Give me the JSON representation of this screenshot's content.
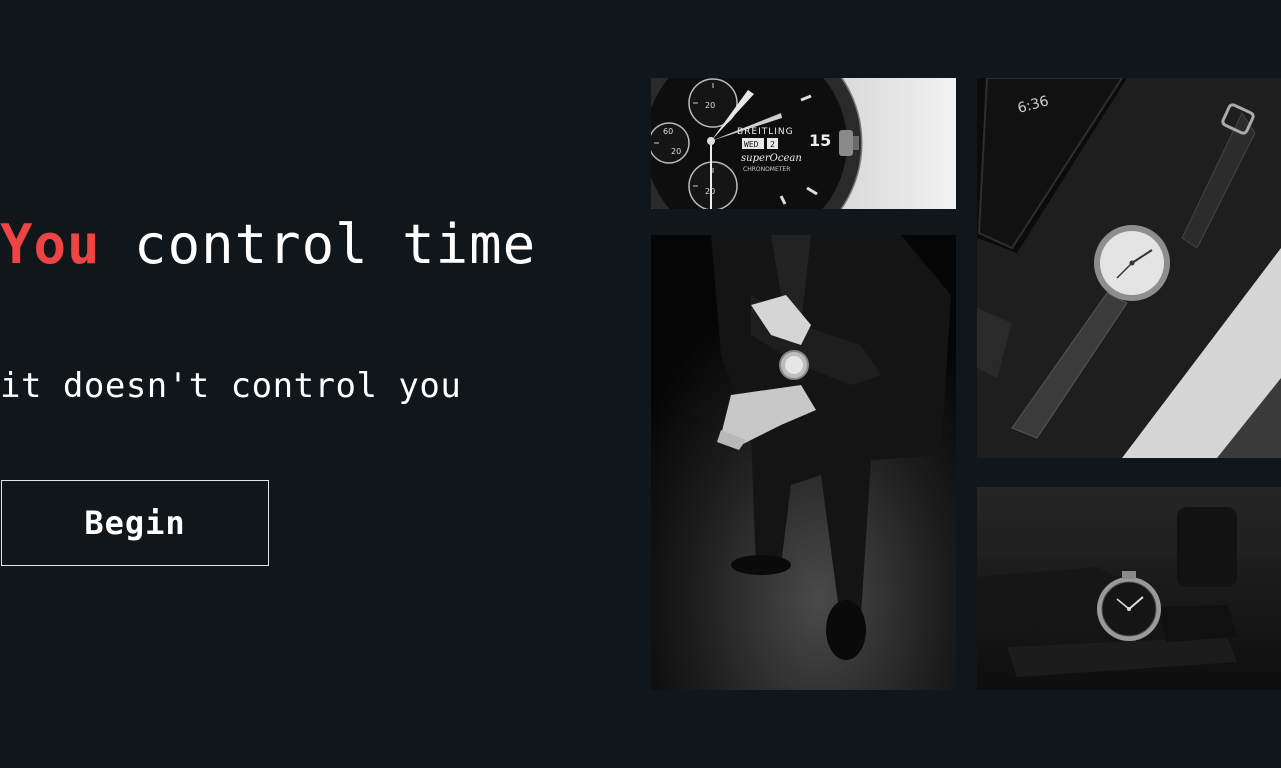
{
  "hero": {
    "title_accent": "You",
    "title_rest": " control time",
    "subtitle": "it doesn't control you",
    "cta_label": "Begin"
  },
  "gallery": {
    "tile1": {
      "brand": "BREITLING",
      "day": "WED",
      "date": "2",
      "model": "superOcean",
      "model_sub": "CHRONOMETER",
      "bezel_marker": "15"
    },
    "tile3": {
      "phone_time": "6:36"
    }
  },
  "colors": {
    "background": "#10161a",
    "accent": "#ef4444",
    "text": "#ffffff",
    "button_border": "#e6e6e6"
  }
}
